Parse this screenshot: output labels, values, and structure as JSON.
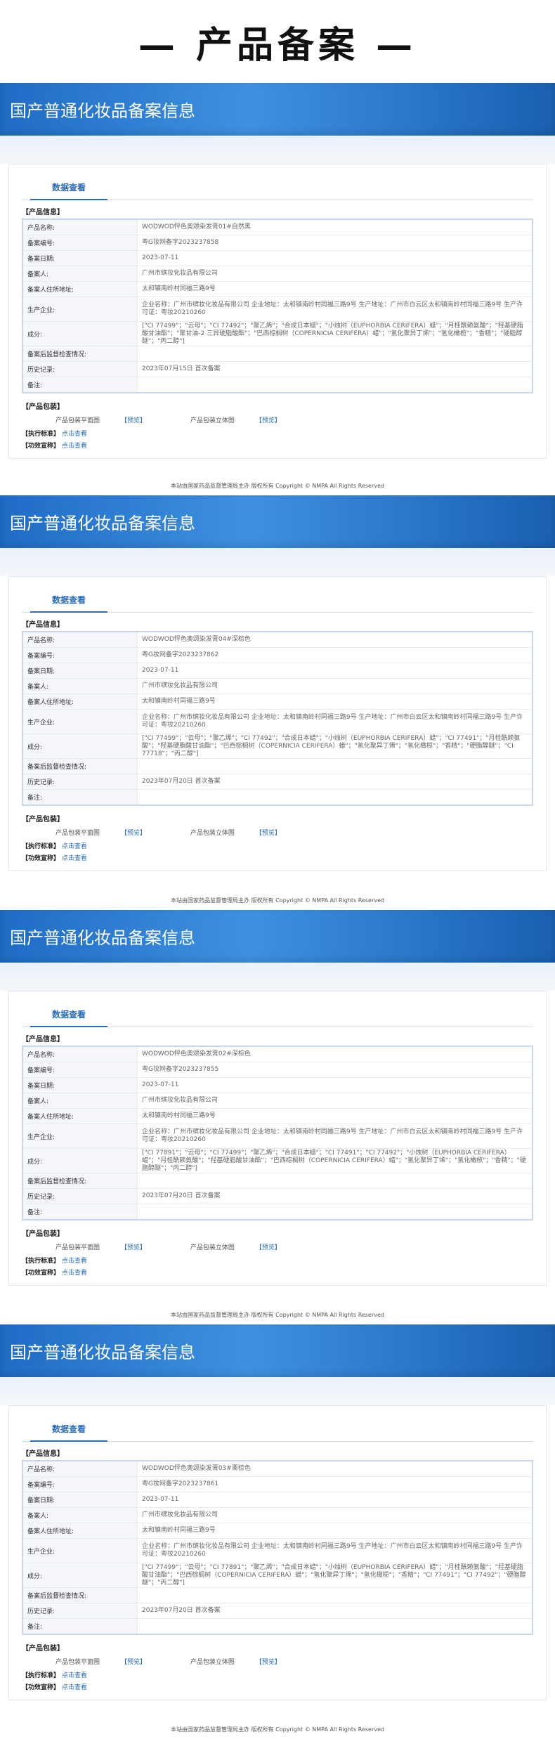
{
  "page_title": "— 产品备案 —",
  "banner_title": "国产普通化妆品备案信息",
  "tab_label": "数据查看",
  "section_title": "【产品信息】",
  "labels": {
    "product_name": "产品名称:",
    "filing_no": "备案编号:",
    "filing_date": "备案日期:",
    "filer": "备案人:",
    "filer_address": "备案人住所地址:",
    "manufacturer": "生产企业:",
    "ingredients": "成分:",
    "inspection": "备案后监督检查情况:",
    "history": "历史记录:",
    "remark": "备注:"
  },
  "pack_title": "【产品包装】",
  "pack_flat": "产品包装平面图",
  "pack_3d": "产品包装立体图",
  "view_link": "【预览】",
  "exec_label": "【执行标准】",
  "efficacy_label": "【功效宣称】",
  "click_view": "点击查看",
  "footer": "本站由国家药品监督管理局主办 版权所有 Copyright © NMPA All Rights Reserved",
  "records": [
    {
      "product_name": "WODWOD怦色奥颂染发膏01#自然黑",
      "filing_no": "粤G妆网备字2023237858",
      "filing_date": "2023-07-11",
      "filer": "广州市缤妆化妆品有限公司",
      "filer_address": "太和镇南岭村同福三路9号",
      "manufacturer": "企业名称：广州市缤妆化妆品有限公司 企业地址：太和镇南岭村同福三路9号 生产地址：广州市白云区太和镇南岭村同福三路9号 生产许可证：粤妆20210260",
      "ingredients": "[\"CI 77499\"；\"云母\"；\"CI 77492\"；\"聚乙烯\"；\"合成日本蜡\"；\"小烛树（EUPHORBIA CERIFERA）蜡\"；\"月桂酰赖氨酸\"；\"羟基硬脂酸甘油酯\"；\"聚甘油-2 三异硬脂酸酯\"；\"巴西棕榈树（COPERNICIA CERIFERA）蜡\"；\"氢化聚异丁烯\"；\"氢化橄榄\"；\"香精\"；\"硬脂醇醚\"；\"丙二醇\"]",
      "inspection": "",
      "history": "2023年07月15日 首次备案",
      "remark": ""
    },
    {
      "product_name": "WODWOD怦色奥颂染发膏04#深棕色",
      "filing_no": "粤G妆网备字2023237862",
      "filing_date": "2023-07-11",
      "filer": "广州市缤妆化妆品有限公司",
      "filer_address": "太和镇南岭村同福三路9号",
      "manufacturer": "企业名称：广州市缤妆化妆品有限公司 企业地址：太和镇南岭村同福三路9号 生产地址：广州市白云区太和镇南岭村同福三路9号 生产许可证：粤妆20210260",
      "ingredients": "[\"CI 77499\"；\"云母\"；\"聚乙烯\"；\"CI 77492\"；\"合成日本蜡\"；\"小烛树（EUPHORBIA CERIFERA）蜡\"；\"CI 77491\"；\"月桂酰赖氨酸\"；\"羟基硬脂酸甘油酯\"；\"巴西棕榈树（COPERNICIA CERIFERA）蜡\"；\"氢化聚异丁烯\"；\"氢化橄榄\"；\"香精\"；\"硬脂醇醚\"；\"CI 77718\"；\"丙二醇\"]",
      "inspection": "",
      "history": "2023年07月20日 首次备案",
      "remark": ""
    },
    {
      "product_name": "WODWOD怦色奥颂染发膏02#深棕色",
      "filing_no": "粤G妆网备字2023237855",
      "filing_date": "2023-07-11",
      "filer": "广州市缤妆化妆品有限公司",
      "filer_address": "太和镇南岭村同福三路9号",
      "manufacturer": "企业名称：广州市缤妆化妆品有限公司 企业地址：太和镇南岭村同福三路9号 生产地址：广州市白云区太和镇南岭村同福三路9号 生产许可证：粤妆20210260",
      "ingredients": "[\"CI 77891\"；\"云母\"；\"CI 77499\"；\"聚乙烯\"；\"合成日本蜡\"；\"CI 77491\"；\"CI 77492\"；\"小烛树（EUPHORBIA CERIFERA）蜡\"；\"月桂酰赖氨酸\"；\"羟基硬脂酸甘油酯\"；\"巴西棕榈树（COPERNICIA CERIFERA）蜡\"；\"氢化聚异丁烯\"；\"氢化橄榄\"；\"香精\"；\"硬脂醇醚\"；\"丙二醇\"]",
      "inspection": "",
      "history": "2023年07月20日 首次备案",
      "remark": ""
    },
    {
      "product_name": "WODWOD怦色奥颂染发膏03#栗棕色",
      "filing_no": "粤G妆网备字2023237861",
      "filing_date": "2023-07-11",
      "filer": "广州市缤妆化妆品有限公司",
      "filer_address": "太和镇南岭村同福三路9号",
      "manufacturer": "企业名称：广州市缤妆化妆品有限公司 企业地址：太和镇南岭村同福三路9号 生产地址：广州市白云区太和镇南岭村同福三路9号 生产许可证：粤妆20210260",
      "ingredients": "[\"CI 77499\"；\"云母\"；\"CI 77891\"；\"聚乙烯\"；\"合成日本蜡\"；\"小烛树（EUPHORBIA CERIFERA）蜡\"；\"月桂酰赖氨酸\"；\"羟基硬脂酸甘油酯\"；\"巴西棕榈树（COPERNICIA CERIFERA）蜡\"；\"氢化聚异丁烯\"；\"氢化橄榄\"；\"香精\"；\"CI 77491\"；\"CI 77492\"；\"硬脂醇醚\"；\"丙二醇\"]",
      "inspection": "",
      "history": "2023年07月20日 首次备案",
      "remark": ""
    }
  ]
}
